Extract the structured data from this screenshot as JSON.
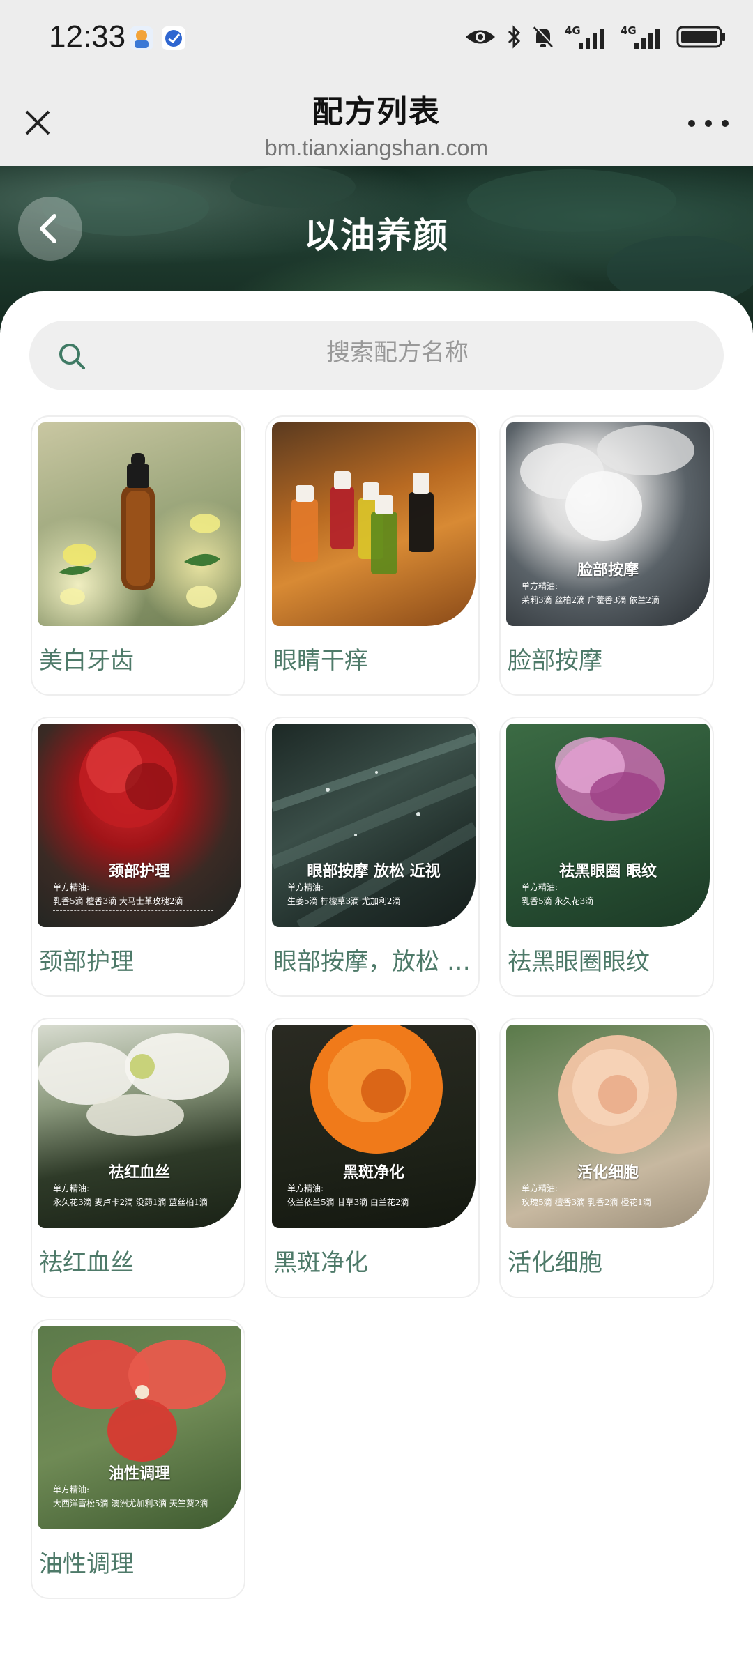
{
  "status": {
    "time": "12:33",
    "network_1": "4G",
    "network_2": "4G"
  },
  "titlebar": {
    "title": "配方列表",
    "url": "bm.tianxiangshan.com"
  },
  "hero": {
    "title": "以油养颜"
  },
  "search": {
    "placeholder": "搜索配方名称"
  },
  "cards": [
    {
      "label": "美白牙齿",
      "image_title": "",
      "subtitle": "",
      "line": ""
    },
    {
      "label": "眼睛干痒",
      "image_title": "",
      "subtitle": "",
      "line": ""
    },
    {
      "label": "脸部按摩",
      "image_title": "脸部按摩",
      "subtitle": "单方精油:",
      "line": "茉莉3滴  丝柏2滴  广藿香3滴  依兰2滴"
    },
    {
      "label": "颈部护理",
      "image_title": "颈部护理",
      "subtitle": "单方精油:",
      "line": "乳香5滴  檀香3滴  大马士革玫瑰2滴"
    },
    {
      "label": "眼部按摩，放松 近视",
      "image_title": "眼部按摩 放松 近视",
      "subtitle": "单方精油:",
      "line": "生姜5滴  柠檬草3滴  尤加利2滴"
    },
    {
      "label": "祛黑眼圈眼纹",
      "image_title": "祛黑眼圈 眼纹",
      "subtitle": "单方精油:",
      "line": "乳香5滴    永久花3滴"
    },
    {
      "label": "祛红血丝",
      "image_title": "祛红血丝",
      "subtitle": "单方精油:",
      "line": "永久花3滴  麦卢卡2滴  没药1滴  蓝丝柏1滴"
    },
    {
      "label": "黑斑净化",
      "image_title": "黑斑净化",
      "subtitle": "单方精油:",
      "line": "依兰依兰5滴  甘草3滴  白兰花2滴"
    },
    {
      "label": "活化细胞",
      "image_title": "活化细胞",
      "subtitle": "单方精油:",
      "line": "玫瑰5滴  檀香3滴  乳香2滴  橙花1滴"
    },
    {
      "label": "油性调理",
      "image_title": "油性调理",
      "subtitle": "单方精油:",
      "line": "大西洋雪松5滴  澳洲尤加利3滴  天竺葵2滴"
    }
  ]
}
